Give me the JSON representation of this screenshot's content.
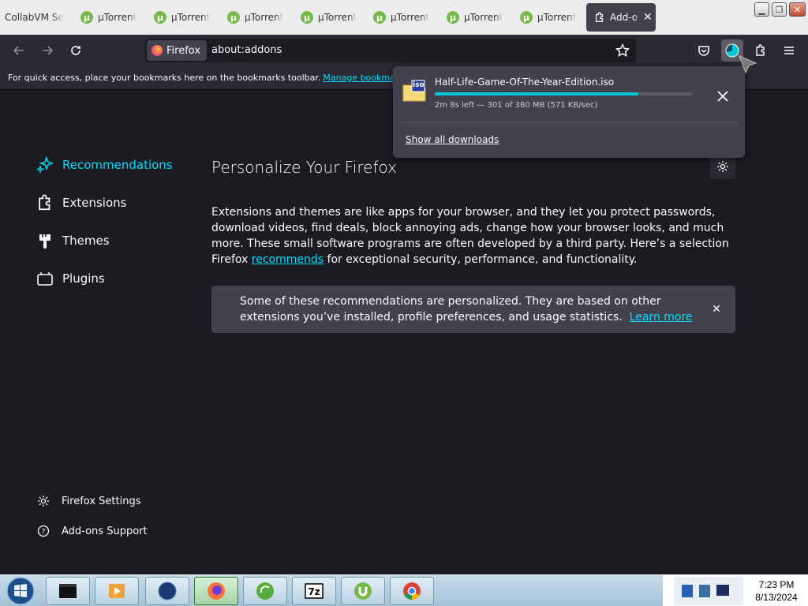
{
  "tabs": [
    {
      "label": "CollabVM Se"
    },
    {
      "label": "µTorrent"
    },
    {
      "label": "µTorrent"
    },
    {
      "label": "µTorrent"
    },
    {
      "label": "µTorrent"
    },
    {
      "label": "µTorrent"
    },
    {
      "label": "µTorrent"
    },
    {
      "label": "µTorrent"
    },
    {
      "label": "Add-o"
    }
  ],
  "navbar": {
    "identity_label": "Firefox",
    "url": "about:addons"
  },
  "bookmarks_bar": {
    "message": "For quick access, place your bookmarks here on the bookmarks toolbar.",
    "link": "Manage bookmarks…"
  },
  "sidebar": {
    "categories": [
      {
        "label": "Recommendations",
        "selected": true
      },
      {
        "label": "Extensions"
      },
      {
        "label": "Themes"
      },
      {
        "label": "Plugins"
      }
    ],
    "footer": [
      {
        "label": "Firefox Settings"
      },
      {
        "label": "Add-ons Support"
      }
    ]
  },
  "main": {
    "heading": "Personalize Your Firefox",
    "description_pre": "Extensions and themes are like apps for your browser, and they let you protect passwords, download videos, find deals, block annoying ads, change how your browser looks, and much more. These small software programs are often developed by a third party. Here’s a selection Firefox ",
    "description_link": "recommends",
    "description_post": " for exceptional security, performance, and functionality.",
    "notice_text": "Some of these recommendations are personalized. They are based on other extensions you’ve installed, profile preferences, and usage statistics.",
    "notice_link": "Learn more"
  },
  "downloads": {
    "filename": "Half-Life-Game-Of-The-Year-Edition.iso",
    "file_icon_label": "iso",
    "status": "2m 8s left — 301 of 380 MB (571 KB/sec)",
    "progress": 0.79,
    "show_all": "Show all downloads"
  },
  "taskbar": {
    "time": "7:23 PM",
    "date": "8/13/2024"
  },
  "colors": {
    "accent": "#00ddff",
    "progress": "#00c8d7",
    "panel": "#42414d",
    "background": "#1c1b22"
  }
}
